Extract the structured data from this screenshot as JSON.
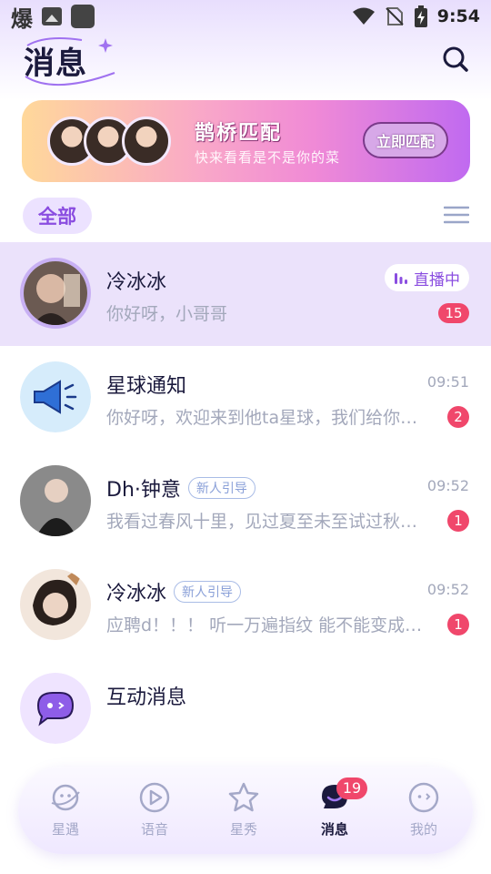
{
  "status_bar": {
    "brand_glyph": "爆",
    "time": "9:54"
  },
  "header": {
    "title": "消息"
  },
  "banner": {
    "title": "鹊桥匹配",
    "subtitle": "快来看看是不是你的菜",
    "button_label": "立即匹配"
  },
  "filter": {
    "all_label": "全部"
  },
  "chats": [
    {
      "name": "冷冰冰",
      "preview": "你好呀，小哥哥",
      "time": "",
      "live": "直播中",
      "unread": "15",
      "tag": ""
    },
    {
      "name": "星球通知",
      "preview": "你好呀，欢迎来到他ta星球，我们给你准备了新人礼包",
      "time": "09:51",
      "live": "",
      "unread": "2",
      "tag": ""
    },
    {
      "name": "Dh·钟意",
      "preview": "我看过春风十里，见过夏至未至试过秋风萧瑟",
      "time": "09:52",
      "live": "",
      "unread": "1",
      "tag": "新人引导"
    },
    {
      "name": "冷冰冰",
      "preview": "应聘d！！！ 听一万遍指纹 能不能变成你的专属",
      "time": "09:52",
      "live": "",
      "unread": "1",
      "tag": "新人引导"
    },
    {
      "name": "互动消息",
      "preview": "",
      "time": "",
      "live": "",
      "unread": "",
      "tag": ""
    }
  ],
  "nav": {
    "items": [
      {
        "label": "星遇",
        "icon": "planet-face-icon"
      },
      {
        "label": "语音",
        "icon": "play-circle-icon"
      },
      {
        "label": "星秀",
        "icon": "star-icon"
      },
      {
        "label": "消息",
        "icon": "chat-bubble-icon",
        "badge": "19"
      },
      {
        "label": "我的",
        "icon": "profile-face-icon"
      }
    ]
  },
  "colors": {
    "accent": "#8a4de0",
    "unread": "#f0476b",
    "highlight_row": "#ebe2fb",
    "title_text": "#1b1a3d",
    "secondary_text": "#a3a8bb"
  }
}
